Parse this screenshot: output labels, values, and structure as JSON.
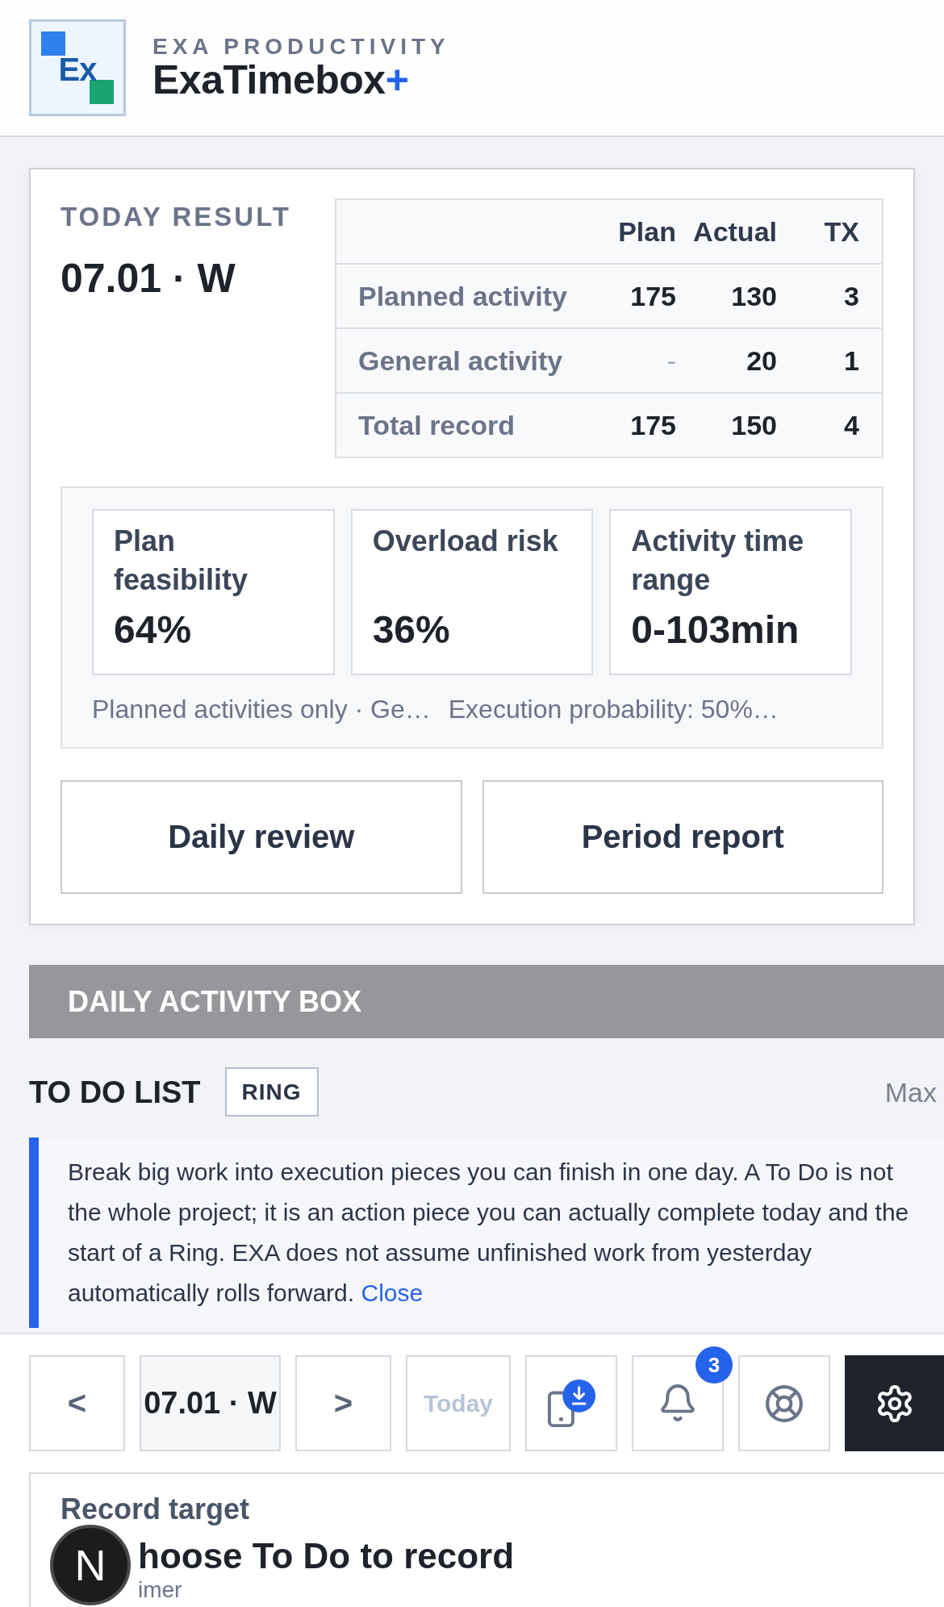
{
  "header": {
    "logo_text": "Ex",
    "company": "EXA PRODUCTIVITY",
    "app_name": "ExaTimebox",
    "app_name_suffix": "+"
  },
  "today_result": {
    "title": "TODAY RESULT",
    "date": "07.01 · W",
    "table": {
      "columns": [
        "Plan",
        "Actual",
        "TX"
      ],
      "rows": [
        {
          "label": "Planned activity",
          "cells": [
            {
              "text": "175",
              "muted": false
            },
            {
              "text": "130",
              "muted": false
            },
            {
              "text": "3",
              "muted": false
            }
          ]
        },
        {
          "label": "General activity",
          "cells": [
            {
              "text": "-",
              "muted": true
            },
            {
              "text": "20",
              "muted": false
            },
            {
              "text": "1",
              "muted": false
            }
          ]
        },
        {
          "label": "Total record",
          "cells": [
            {
              "text": "175",
              "muted": false
            },
            {
              "text": "150",
              "muted": false
            },
            {
              "text": "4",
              "muted": false
            }
          ]
        }
      ]
    },
    "metrics": [
      {
        "label": "Plan feasibility",
        "value": "64%"
      },
      {
        "label": "Overload risk",
        "value": "36%"
      },
      {
        "label": "Activity time range",
        "value": "0-103min"
      }
    ],
    "notes": [
      "Planned activities only · Ge…",
      "Execution probability: 50%…"
    ],
    "buttons": [
      "Daily review",
      "Period report"
    ]
  },
  "daily_activity_box": {
    "title": "DAILY ACTIVITY BOX",
    "todo": {
      "title": "TO DO LIST",
      "tag": "RING",
      "limit": "Max",
      "info": {
        "text": "Break big work into execution pieces you can finish in one day. A To Do is not the whole project; it is an action piece you can actually complete today and the start of a Ring. EXA does not assume unfinished work from yesterday automatically rolls forward.",
        "link": "Close"
      }
    }
  },
  "bottom_bar": {
    "prev": "<",
    "date": "07.01 · W",
    "next": ">",
    "today": {
      "label": "Today",
      "disabled": true
    },
    "notification_count": "3"
  },
  "record_target": {
    "label": "Record target",
    "title": "hoose To Do to record",
    "subtitle": "imer"
  },
  "dev_button": "N"
}
